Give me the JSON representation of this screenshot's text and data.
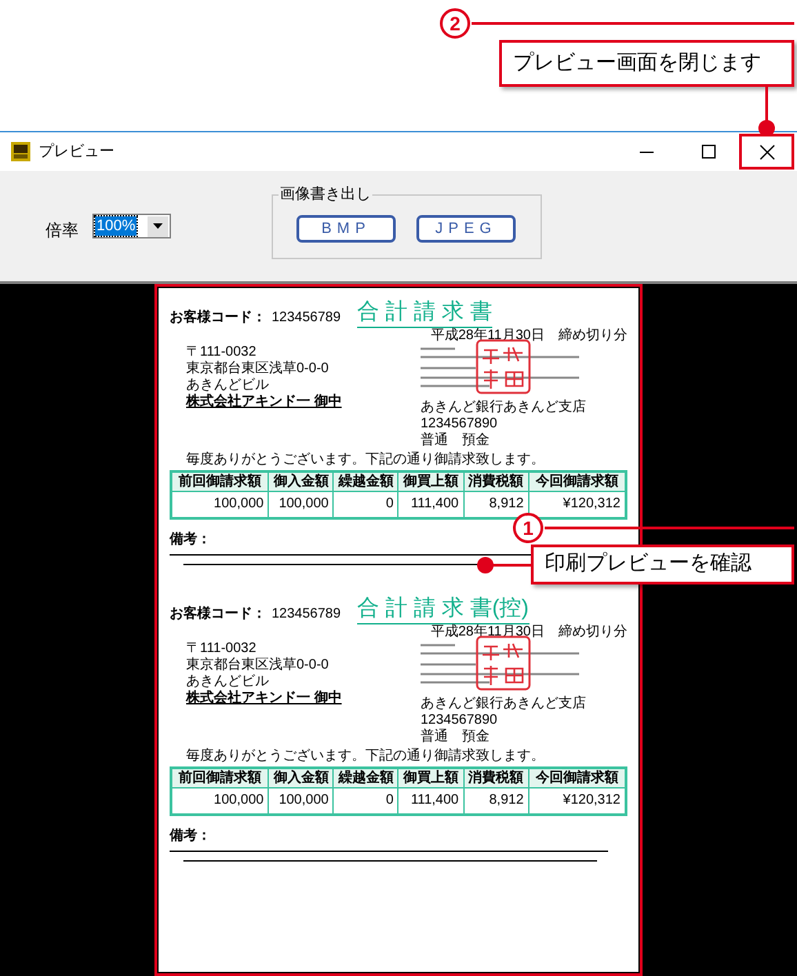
{
  "window": {
    "title": "プレビュー"
  },
  "zoom": {
    "label": "倍率",
    "value": "100%"
  },
  "export": {
    "legend": "画像書き出し",
    "buttons": [
      "BMP",
      "JPEG"
    ]
  },
  "invoices": [
    {
      "title": "合 計 請 求 書",
      "code_label": "お客様コード：",
      "code": "123456789",
      "date": "平成28年11月30日　締め切り分",
      "address": [
        "〒111-0032",
        "東京都台東区浅草0-0-0",
        "あきんどビル",
        "株式会社アキンド一 御中"
      ],
      "bank": [
        "あきんど銀行あきんど支店",
        "1234567890",
        "普通　預金"
      ],
      "message": "毎度ありがとうございます。下記の通り御請求致します。",
      "columns": [
        "前回御請求額",
        "御入金額",
        "繰越金額",
        "御買上額",
        "消費税額",
        "今回御請求額"
      ],
      "values": [
        "100,000",
        "100,000",
        "0",
        "111,400",
        "8,912",
        "¥120,312"
      ],
      "remarks_label": "備考："
    },
    {
      "title": "合 計 請 求 書(控)",
      "code_label": "お客様コード：",
      "code": "123456789",
      "date": "平成28年11月30日　締め切り分",
      "address": [
        "〒111-0032",
        "東京都台東区浅草0-0-0",
        "あきんどビル",
        "株式会社アキンド一 御中"
      ],
      "bank": [
        "あきんど銀行あきんど支店",
        "1234567890",
        "普通　預金"
      ],
      "message": "毎度ありがとうございます。下記の通り御請求致します。",
      "columns": [
        "前回御請求額",
        "御入金額",
        "繰越金額",
        "御買上額",
        "消費税額",
        "今回御請求額"
      ],
      "values": [
        "100,000",
        "100,000",
        "0",
        "111,400",
        "8,912",
        "¥120,312"
      ],
      "remarks_label": "備考："
    }
  ],
  "annotations": [
    {
      "kind": "close",
      "number": "2",
      "text": "プレビュー画面を閉じます"
    },
    {
      "kind": "page",
      "number": "1",
      "text": "印刷プレビューを確認"
    }
  ]
}
